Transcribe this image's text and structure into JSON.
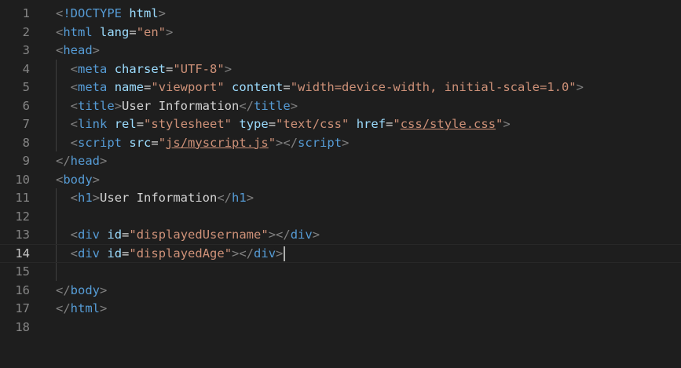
{
  "lines": [
    {
      "num": "1",
      "tokens": [
        [
          "punc",
          "<"
        ],
        [
          "tag",
          "!DOCTYPE"
        ],
        [
          "text",
          " "
        ],
        [
          "attr",
          "html"
        ],
        [
          "punc",
          ">"
        ]
      ]
    },
    {
      "num": "2",
      "tokens": [
        [
          "punc",
          "<"
        ],
        [
          "tag",
          "html"
        ],
        [
          "text",
          " "
        ],
        [
          "attr",
          "lang"
        ],
        [
          "eq",
          "="
        ],
        [
          "str",
          "\"en\""
        ],
        [
          "punc",
          ">"
        ]
      ]
    },
    {
      "num": "3",
      "tokens": [
        [
          "punc",
          "<"
        ],
        [
          "tag",
          "head"
        ],
        [
          "punc",
          ">"
        ]
      ]
    },
    {
      "num": "4",
      "tokens": [
        [
          "text",
          "  "
        ],
        [
          "punc",
          "<"
        ],
        [
          "tag",
          "meta"
        ],
        [
          "text",
          " "
        ],
        [
          "attr",
          "charset"
        ],
        [
          "eq",
          "="
        ],
        [
          "str",
          "\"UTF-8\""
        ],
        [
          "punc",
          ">"
        ]
      ]
    },
    {
      "num": "5",
      "tokens": [
        [
          "text",
          "  "
        ],
        [
          "punc",
          "<"
        ],
        [
          "tag",
          "meta"
        ],
        [
          "text",
          " "
        ],
        [
          "attr",
          "name"
        ],
        [
          "eq",
          "="
        ],
        [
          "str",
          "\"viewport\""
        ],
        [
          "text",
          " "
        ],
        [
          "attr",
          "content"
        ],
        [
          "eq",
          "="
        ],
        [
          "str",
          "\"width=device-width, initial-scale=1.0\""
        ],
        [
          "punc",
          ">"
        ]
      ]
    },
    {
      "num": "6",
      "tokens": [
        [
          "text",
          "  "
        ],
        [
          "punc",
          "<"
        ],
        [
          "tag",
          "title"
        ],
        [
          "punc",
          ">"
        ],
        [
          "text",
          "User Information"
        ],
        [
          "punc",
          "</"
        ],
        [
          "tag",
          "title"
        ],
        [
          "punc",
          ">"
        ]
      ]
    },
    {
      "num": "7",
      "tokens": [
        [
          "text",
          "  "
        ],
        [
          "punc",
          "<"
        ],
        [
          "tag",
          "link"
        ],
        [
          "text",
          " "
        ],
        [
          "attr",
          "rel"
        ],
        [
          "eq",
          "="
        ],
        [
          "str",
          "\"stylesheet\""
        ],
        [
          "text",
          " "
        ],
        [
          "attr",
          "type"
        ],
        [
          "eq",
          "="
        ],
        [
          "str",
          "\"text/css\""
        ],
        [
          "text",
          " "
        ],
        [
          "attr",
          "href"
        ],
        [
          "eq",
          "="
        ],
        [
          "str",
          "\""
        ],
        [
          "link",
          "css/style.css"
        ],
        [
          "str",
          "\""
        ],
        [
          "punc",
          ">"
        ]
      ]
    },
    {
      "num": "8",
      "tokens": [
        [
          "text",
          "  "
        ],
        [
          "punc",
          "<"
        ],
        [
          "tag",
          "script"
        ],
        [
          "text",
          " "
        ],
        [
          "attr",
          "src"
        ],
        [
          "eq",
          "="
        ],
        [
          "str",
          "\""
        ],
        [
          "link",
          "js/myscript.js"
        ],
        [
          "str",
          "\""
        ],
        [
          "punc",
          "></"
        ],
        [
          "tag",
          "script"
        ],
        [
          "punc",
          ">"
        ]
      ]
    },
    {
      "num": "9",
      "tokens": [
        [
          "punc",
          "</"
        ],
        [
          "tag",
          "head"
        ],
        [
          "punc",
          ">"
        ]
      ]
    },
    {
      "num": "10",
      "tokens": [
        [
          "punc",
          "<"
        ],
        [
          "tag",
          "body"
        ],
        [
          "punc",
          ">"
        ]
      ]
    },
    {
      "num": "11",
      "tokens": [
        [
          "text",
          "  "
        ],
        [
          "punc",
          "<"
        ],
        [
          "tag",
          "h1"
        ],
        [
          "punc",
          ">"
        ],
        [
          "text",
          "User Information"
        ],
        [
          "punc",
          "</"
        ],
        [
          "tag",
          "h1"
        ],
        [
          "punc",
          ">"
        ]
      ]
    },
    {
      "num": "12",
      "tokens": []
    },
    {
      "num": "13",
      "tokens": [
        [
          "text",
          "  "
        ],
        [
          "punc",
          "<"
        ],
        [
          "tag",
          "div"
        ],
        [
          "text",
          " "
        ],
        [
          "attr",
          "id"
        ],
        [
          "eq",
          "="
        ],
        [
          "str",
          "\"displayedUsername\""
        ],
        [
          "punc",
          "></"
        ],
        [
          "tag",
          "div"
        ],
        [
          "punc",
          ">"
        ]
      ]
    },
    {
      "num": "14",
      "tokens": [
        [
          "text",
          "  "
        ],
        [
          "punc",
          "<"
        ],
        [
          "tag",
          "div"
        ],
        [
          "text",
          " "
        ],
        [
          "attr",
          "id"
        ],
        [
          "eq",
          "="
        ],
        [
          "str",
          "\"displayedAge\""
        ],
        [
          "punc",
          "></"
        ],
        [
          "tag",
          "div"
        ],
        [
          "punc",
          ">"
        ]
      ],
      "current": true
    },
    {
      "num": "15",
      "tokens": []
    },
    {
      "num": "16",
      "tokens": [
        [
          "punc",
          "</"
        ],
        [
          "tag",
          "body"
        ],
        [
          "punc",
          ">"
        ]
      ]
    },
    {
      "num": "17",
      "tokens": [
        [
          "punc",
          "</"
        ],
        [
          "tag",
          "html"
        ],
        [
          "punc",
          ">"
        ]
      ]
    },
    {
      "num": "18",
      "tokens": []
    }
  ]
}
